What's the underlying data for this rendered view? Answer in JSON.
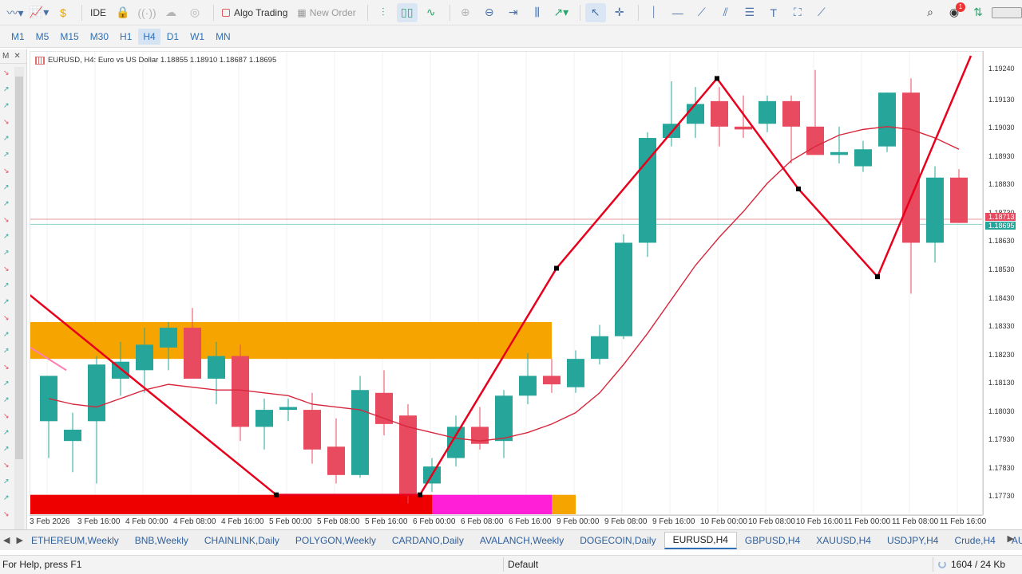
{
  "toolbar": {
    "ide_label": "IDE",
    "algo_label": "Algo Trading",
    "new_order_label": "New Order",
    "notification_count": "1"
  },
  "timeframes": [
    "M1",
    "M5",
    "M15",
    "M30",
    "H1",
    "H4",
    "D1",
    "W1",
    "MN"
  ],
  "active_timeframe": "H4",
  "left_panel": {
    "label_m": "M",
    "close_glyph": "✕"
  },
  "chart": {
    "header": "EURUSD, H4:  Euro vs US Dollar  1.18855 1.18910 1.18687 1.18695",
    "symbol": "EURUSD",
    "timeframe": "H4",
    "description": "Euro vs US Dollar",
    "ohlc": {
      "open": 1.18855,
      "high": 1.1891,
      "low": 1.18687,
      "close": 1.18695
    },
    "price_labels": [
      "1.19240",
      "1.19130",
      "1.19030",
      "1.18930",
      "1.18830",
      "1.18730",
      "1.18630",
      "1.18530",
      "1.18430",
      "1.18330",
      "1.18230",
      "1.18130",
      "1.18030",
      "1.17930",
      "1.17830",
      "1.17730"
    ],
    "price_tag_bid": "1.18713",
    "price_tag_last": "1.18695",
    "time_labels": [
      "3 Feb 2026",
      "3 Feb 16:00",
      "4 Feb 00:00",
      "4 Feb 08:00",
      "4 Feb 16:00",
      "5 Feb 00:00",
      "5 Feb 08:00",
      "5 Feb 16:00",
      "6 Feb 00:00",
      "6 Feb 08:00",
      "6 Feb 16:00",
      "9 Feb 00:00",
      "9 Feb 08:00",
      "9 Feb 16:00",
      "10 Feb 00:00",
      "10 Feb 08:00",
      "10 Feb 16:00",
      "11 Feb 00:00",
      "11 Feb 08:00",
      "11 Feb 16:00"
    ],
    "colors": {
      "bull": "#26a69a",
      "bear": "#e84a5f",
      "zigzag": "#e8001c",
      "ma": "#d8263c",
      "supply_zone": "#f6a400",
      "demand_zone": "#ee0000",
      "magenta": "#ff1fd6"
    }
  },
  "chart_data": {
    "type": "candlestick",
    "ylim": [
      1.1768,
      1.1929
    ],
    "candles": [
      {
        "o": 1.18,
        "h": 1.1812,
        "l": 1.1787,
        "c": 1.1816
      },
      {
        "o": 1.1793,
        "h": 1.1803,
        "l": 1.1782,
        "c": 1.1797
      },
      {
        "o": 1.18,
        "h": 1.1823,
        "l": 1.1778,
        "c": 1.182
      },
      {
        "o": 1.1815,
        "h": 1.1828,
        "l": 1.1809,
        "c": 1.1821
      },
      {
        "o": 1.1818,
        "h": 1.1833,
        "l": 1.181,
        "c": 1.1827
      },
      {
        "o": 1.1826,
        "h": 1.1835,
        "l": 1.1818,
        "c": 1.1833
      },
      {
        "o": 1.1833,
        "h": 1.184,
        "l": 1.1817,
        "c": 1.1815
      },
      {
        "o": 1.1815,
        "h": 1.1828,
        "l": 1.1806,
        "c": 1.1823
      },
      {
        "o": 1.1823,
        "h": 1.1827,
        "l": 1.1793,
        "c": 1.1798
      },
      {
        "o": 1.1798,
        "h": 1.1808,
        "l": 1.179,
        "c": 1.1804
      },
      {
        "o": 1.1804,
        "h": 1.1808,
        "l": 1.18,
        "c": 1.1805
      },
      {
        "o": 1.1804,
        "h": 1.181,
        "l": 1.1785,
        "c": 1.179
      },
      {
        "o": 1.1791,
        "h": 1.1801,
        "l": 1.1778,
        "c": 1.1781
      },
      {
        "o": 1.1781,
        "h": 1.1816,
        "l": 1.178,
        "c": 1.1811
      },
      {
        "o": 1.181,
        "h": 1.1818,
        "l": 1.1795,
        "c": 1.1799
      },
      {
        "o": 1.1802,
        "h": 1.1806,
        "l": 1.1771,
        "c": 1.1774
      },
      {
        "o": 1.1778,
        "h": 1.1787,
        "l": 1.1775,
        "c": 1.1784
      },
      {
        "o": 1.1787,
        "h": 1.1802,
        "l": 1.1784,
        "c": 1.1798
      },
      {
        "o": 1.1798,
        "h": 1.1805,
        "l": 1.179,
        "c": 1.1792
      },
      {
        "o": 1.1793,
        "h": 1.1811,
        "l": 1.1787,
        "c": 1.1809
      },
      {
        "o": 1.1809,
        "h": 1.1824,
        "l": 1.1806,
        "c": 1.1816
      },
      {
        "o": 1.1816,
        "h": 1.1822,
        "l": 1.181,
        "c": 1.1813
      },
      {
        "o": 1.1812,
        "h": 1.1825,
        "l": 1.181,
        "c": 1.1822
      },
      {
        "o": 1.1822,
        "h": 1.1834,
        "l": 1.182,
        "c": 1.183
      },
      {
        "o": 1.183,
        "h": 1.1866,
        "l": 1.1829,
        "c": 1.1863
      },
      {
        "o": 1.1863,
        "h": 1.1902,
        "l": 1.1858,
        "c": 1.19
      },
      {
        "o": 1.19,
        "h": 1.192,
        "l": 1.1897,
        "c": 1.1905
      },
      {
        "o": 1.1905,
        "h": 1.1918,
        "l": 1.19,
        "c": 1.1912
      },
      {
        "o": 1.1913,
        "h": 1.1918,
        "l": 1.1897,
        "c": 1.1904
      },
      {
        "o": 1.1904,
        "h": 1.1915,
        "l": 1.19,
        "c": 1.1903
      },
      {
        "o": 1.1905,
        "h": 1.1915,
        "l": 1.1902,
        "c": 1.1913
      },
      {
        "o": 1.1913,
        "h": 1.1915,
        "l": 1.1891,
        "c": 1.1904
      },
      {
        "o": 1.1904,
        "h": 1.1924,
        "l": 1.1895,
        "c": 1.1894
      },
      {
        "o": 1.1894,
        "h": 1.1904,
        "l": 1.1891,
        "c": 1.1895
      },
      {
        "o": 1.189,
        "h": 1.1899,
        "l": 1.1888,
        "c": 1.1896
      },
      {
        "o": 1.1897,
        "h": 1.1916,
        "l": 1.1895,
        "c": 1.1916
      },
      {
        "o": 1.1916,
        "h": 1.1921,
        "l": 1.1845,
        "c": 1.1863
      },
      {
        "o": 1.1863,
        "h": 1.189,
        "l": 1.1856,
        "c": 1.1886
      },
      {
        "o": 1.1886,
        "h": 1.1889,
        "l": 1.187,
        "c": 1.187
      }
    ],
    "moving_average": [
      1.1808,
      1.1806,
      1.1805,
      1.1808,
      1.1811,
      1.1813,
      1.1812,
      1.1811,
      1.1811,
      1.181,
      1.1809,
      1.1806,
      1.1805,
      1.1804,
      1.1801,
      1.1798,
      1.1796,
      1.1794,
      1.1793,
      1.1794,
      1.1796,
      1.1799,
      1.1803,
      1.181,
      1.182,
      1.1831,
      1.1843,
      1.1855,
      1.1865,
      1.1874,
      1.1884,
      1.1892,
      1.1897,
      1.1901,
      1.1903,
      1.1904,
      1.1903,
      1.19,
      1.1896
    ],
    "zigzag": [
      {
        "i": -1,
        "p": 1.1846
      },
      {
        "i": 9.5,
        "p": 1.1774
      },
      {
        "i": 15.5,
        "p": 1.1774
      },
      {
        "i": 21.2,
        "p": 1.1854
      },
      {
        "i": 27.9,
        "p": 1.1921
      },
      {
        "i": 31.3,
        "p": 1.1882
      },
      {
        "i": 34.6,
        "p": 1.1851
      },
      {
        "i": 38.5,
        "p": 1.1929
      }
    ],
    "zones": [
      {
        "type": "supply",
        "top": 1.1835,
        "bottom": 1.1822,
        "from": -1,
        "to": 21.0
      },
      {
        "type": "demand",
        "top": 1.1774,
        "bottom": 1.1767,
        "from": -1,
        "to": 16.0
      },
      {
        "type": "magenta",
        "top": 1.1774,
        "bottom": 1.1767,
        "from": 16.0,
        "to": 21.0
      },
      {
        "type": "tail",
        "top": 1.1774,
        "bottom": 1.1767,
        "from": 21.0,
        "to": 22.0
      }
    ],
    "hlines": [
      1.18713,
      1.18695
    ]
  },
  "tabs": [
    "ETHEREUM,Weekly",
    "BNB,Weekly",
    "CHAINLINK,Daily",
    "POLYGON,Weekly",
    "CARDANO,Daily",
    "AVALANCH,Weekly",
    "DOGECOIN,Daily",
    "EURUSD,H4",
    "GBPUSD,H4",
    "XAUUSD,H4",
    "USDJPY,H4",
    "Crude,H4",
    "AUDUSD,H"
  ],
  "active_tab": "EURUSD,H4",
  "status": {
    "help": "For Help, press F1",
    "profile": "Default",
    "traffic": "1604 / 24 Kb"
  }
}
